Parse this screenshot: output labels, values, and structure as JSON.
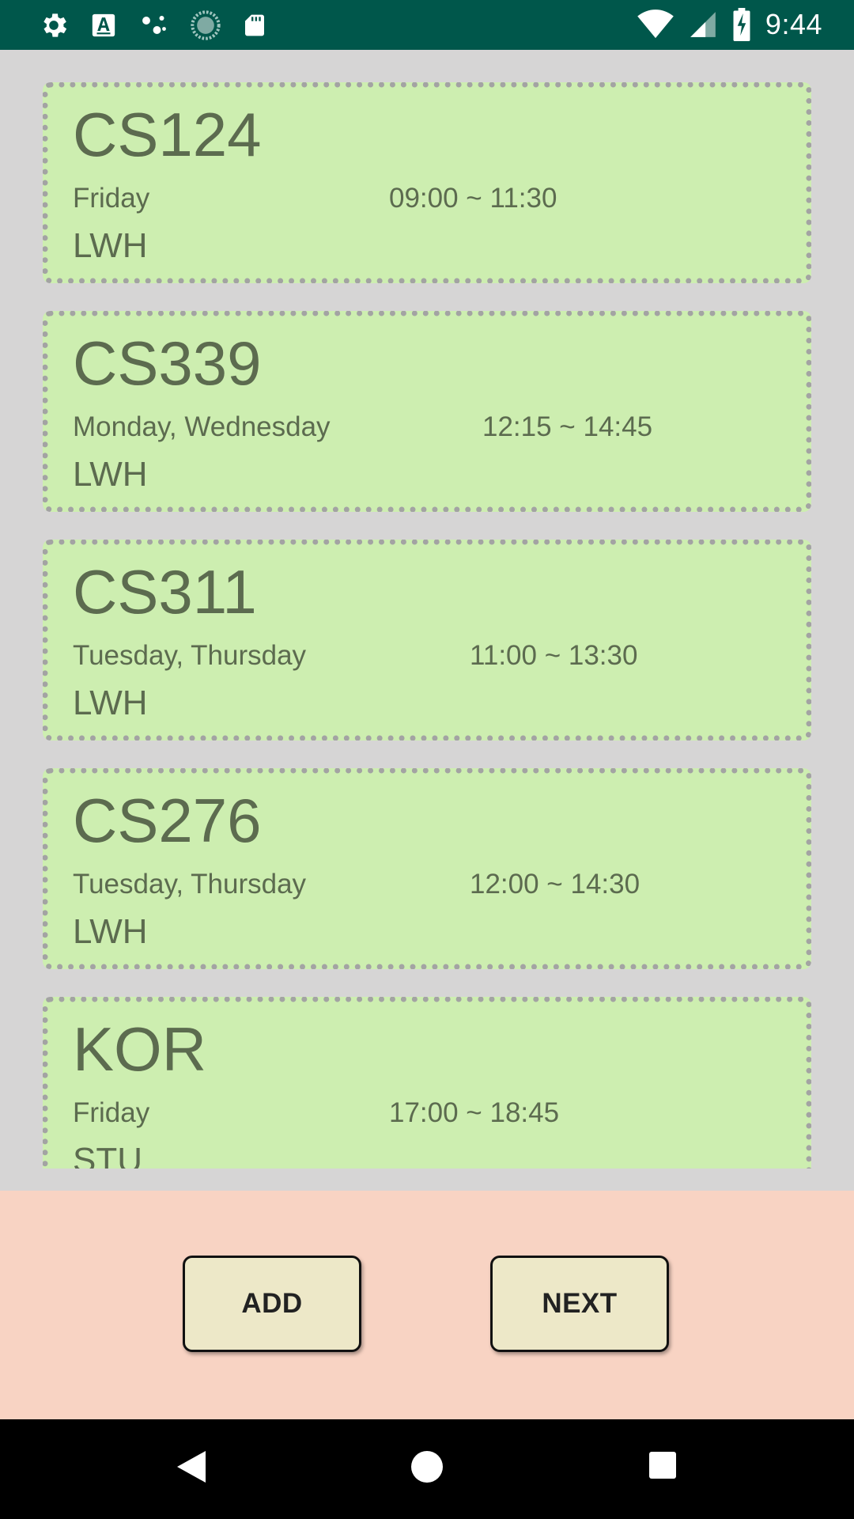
{
  "status_bar": {
    "time": "9:44",
    "left_icons": [
      "gear-icon",
      "font-a-icon",
      "nodes-icon",
      "sync-progress-icon",
      "sd-card-icon"
    ],
    "right_icons": [
      "wifi-icon",
      "signal-icon",
      "battery-charging-icon"
    ]
  },
  "courses": [
    {
      "code": "CS124",
      "days": "Friday",
      "time": "09:00 ~ 11:30",
      "room": "LWH"
    },
    {
      "code": "CS339",
      "days": "Monday, Wednesday",
      "time": "12:15 ~ 14:45",
      "room": "LWH"
    },
    {
      "code": "CS311",
      "days": "Tuesday, Thursday",
      "time": "11:00 ~ 13:30",
      "room": "LWH"
    },
    {
      "code": "CS276",
      "days": "Tuesday, Thursday",
      "time": "12:00 ~ 14:30",
      "room": "LWH"
    },
    {
      "code": "KOR",
      "days": "Friday",
      "time": "17:00 ~ 18:45",
      "room": "STU"
    }
  ],
  "buttons": {
    "add_label": "ADD",
    "next_label": "NEXT"
  },
  "nav_bar": {
    "icons": [
      "back-icon",
      "home-icon",
      "recents-icon"
    ]
  },
  "colors": {
    "status_bar": "#00574b",
    "card_background": "#cdeeb0",
    "card_text": "#5c6b4f",
    "list_background": "#d6d5d5",
    "button_area": "#f8d3c3",
    "button_fill": "#ede8c8"
  }
}
